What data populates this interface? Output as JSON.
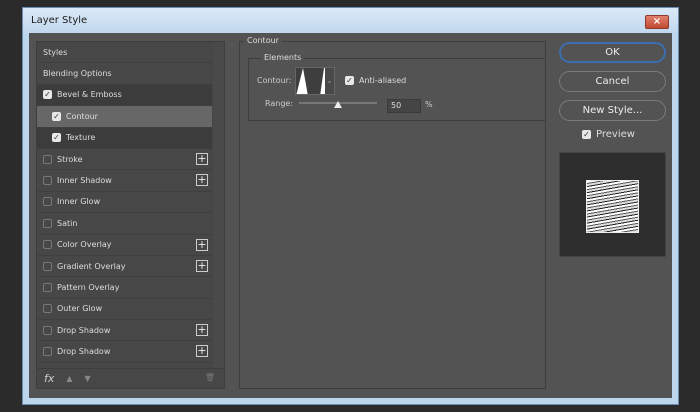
{
  "window": {
    "title": "Layer Style",
    "close_icon": "×"
  },
  "styles_list": [
    {
      "label": "Styles",
      "checkbox": false,
      "plus": false
    },
    {
      "label": "Blending Options",
      "checkbox": false,
      "plus": false
    },
    {
      "label": "Bevel & Emboss",
      "checkbox": true,
      "checked": true,
      "plus": false,
      "selected": true
    },
    {
      "label": "Contour",
      "checkbox": true,
      "checked": true,
      "plus": false,
      "sub": true,
      "highlighted": true
    },
    {
      "label": "Texture",
      "checkbox": true,
      "checked": true,
      "plus": false,
      "sub": true,
      "selected": true
    },
    {
      "label": "Stroke",
      "checkbox": true,
      "checked": false,
      "plus": true
    },
    {
      "label": "Inner Shadow",
      "checkbox": true,
      "checked": false,
      "plus": true
    },
    {
      "label": "Inner Glow",
      "checkbox": true,
      "checked": false,
      "plus": false
    },
    {
      "label": "Satin",
      "checkbox": true,
      "checked": false,
      "plus": false
    },
    {
      "label": "Color Overlay",
      "checkbox": true,
      "checked": false,
      "plus": true
    },
    {
      "label": "Gradient Overlay",
      "checkbox": true,
      "checked": false,
      "plus": true
    },
    {
      "label": "Pattern Overlay",
      "checkbox": true,
      "checked": false,
      "plus": false
    },
    {
      "label": "Outer Glow",
      "checkbox": true,
      "checked": false,
      "plus": false
    },
    {
      "label": "Drop Shadow",
      "checkbox": true,
      "checked": false,
      "plus": true
    },
    {
      "label": "Drop Shadow",
      "checkbox": true,
      "checked": false,
      "plus": true
    }
  ],
  "toolbar": {
    "fx_label": "fx",
    "up_icon": "▲",
    "down_icon": "▼",
    "trash_icon": "🗑"
  },
  "contour_panel": {
    "title": "Contour",
    "group_title": "Elements",
    "contour_label": "Contour:",
    "anti_aliased_label": "Anti-aliased",
    "anti_aliased": true,
    "range_label": "Range:",
    "range_value": "50",
    "range_unit": "%",
    "range_percent": 50
  },
  "buttons": {
    "ok": "OK",
    "cancel": "Cancel",
    "new_style": "New Style..."
  },
  "preview": {
    "label": "Preview",
    "checked": true
  }
}
